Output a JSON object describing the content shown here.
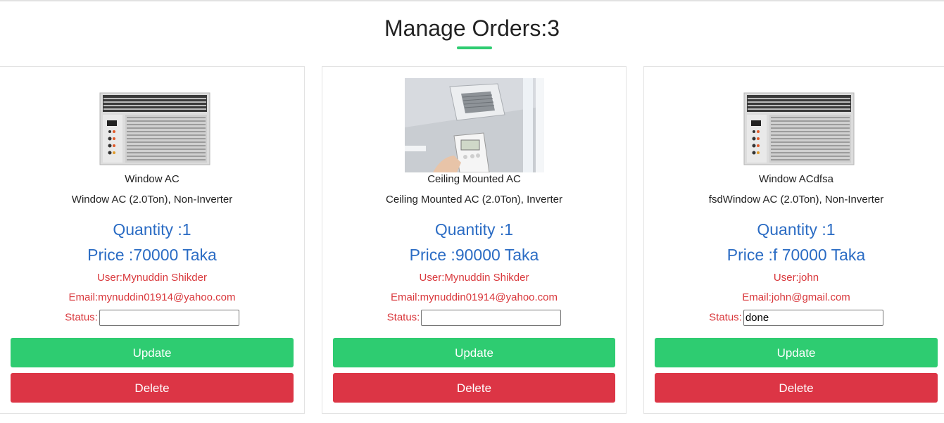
{
  "page": {
    "title": "Manage Orders:3"
  },
  "colors": {
    "accent_green": "#2ecc71",
    "danger_red": "#dc3545",
    "info_blue": "#2b6cc4",
    "user_text_red": "#d9383c"
  },
  "orders": [
    {
      "image_icon": "window-ac-image",
      "name": "Window AC",
      "description": "Window AC (2.0Ton), Non-Inverter",
      "quantity": "Quantity :1",
      "price": "Price :70000 Taka",
      "user": "User:Mynuddin Shikder",
      "email": "Email:mynuddin01914@yahoo.com",
      "status_label": "Status:",
      "status_value": "",
      "update_label": "Update",
      "delete_label": "Delete"
    },
    {
      "image_icon": "ceiling-ac-image",
      "name": "Ceiling Mounted AC",
      "description": "Ceiling Mounted AC (2.0Ton), Inverter",
      "quantity": "Quantity :1",
      "price": "Price :90000 Taka",
      "user": "User:Mynuddin Shikder",
      "email": "Email:mynuddin01914@yahoo.com",
      "status_label": "Status:",
      "status_value": "",
      "update_label": "Update",
      "delete_label": "Delete"
    },
    {
      "image_icon": "window-ac-image",
      "name": "Window ACdfsa",
      "description": "fsdWindow AC (2.0Ton), Non-Inverter",
      "quantity": "Quantity :1",
      "price": "Price :f 70000 Taka",
      "user": "User:john",
      "email": "Email:john@gmail.com",
      "status_label": "Status:",
      "status_value": "done",
      "update_label": "Update",
      "delete_label": "Delete"
    }
  ]
}
